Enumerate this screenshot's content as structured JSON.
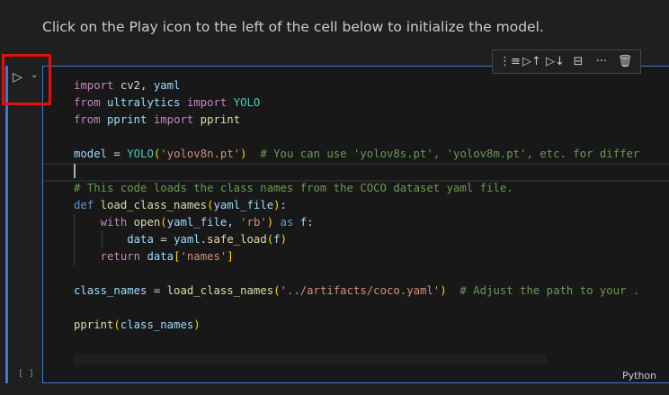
{
  "markdown_text": "Click on the Play icon to the left of the cell below to initialize the model.",
  "cell": {
    "run_icon": "▷",
    "run_menu_icon": "⌄",
    "execution_count": "[ ]",
    "language": "Python",
    "toolbar": [
      {
        "name": "run-by-line-icon",
        "glyph": "⋮≡"
      },
      {
        "name": "execute-above-icon",
        "glyph": "▷↑"
      },
      {
        "name": "execute-below-icon",
        "glyph": "▷↓"
      },
      {
        "name": "split-cell-icon",
        "glyph": "⊟"
      },
      {
        "name": "more-actions-icon",
        "glyph": "···"
      },
      {
        "name": "delete-cell-icon",
        "glyph": "🗑"
      }
    ],
    "code_lines": [
      [
        [
          "import",
          "k"
        ],
        [
          " cv2, ",
          "o"
        ],
        [
          "yaml",
          "v"
        ]
      ],
      [
        [
          "from",
          "k"
        ],
        [
          " ultralytics ",
          "v"
        ],
        [
          "import",
          "k"
        ],
        [
          " YOLO",
          "c"
        ]
      ],
      [
        [
          "from",
          "k"
        ],
        [
          " pprint ",
          "v"
        ],
        [
          "import",
          "k"
        ],
        [
          " pprint",
          "f"
        ]
      ],
      [],
      [
        [
          "model",
          "v"
        ],
        [
          " = ",
          "o"
        ],
        [
          "YOLO",
          "c"
        ],
        [
          "(",
          "p1"
        ],
        [
          "'yolov8n.pt'",
          "s"
        ],
        [
          ")",
          "p1"
        ],
        [
          "  # You can use 'yolov8s.pt', 'yolov8m.pt', etc. for differ",
          "m"
        ]
      ],
      [],
      [
        [
          "# This code loads the class names from the COCO dataset yaml file.",
          "m"
        ]
      ],
      [
        [
          "def",
          "d"
        ],
        [
          " ",
          "o"
        ],
        [
          "load_class_names",
          "f"
        ],
        [
          "(",
          "p1"
        ],
        [
          "yaml_file",
          "v"
        ],
        [
          ")",
          "p1"
        ],
        [
          ":",
          "o"
        ]
      ],
      [
        [
          "    ",
          "o"
        ],
        [
          "with",
          "k"
        ],
        [
          " ",
          "o"
        ],
        [
          "open",
          "f"
        ],
        [
          "(",
          "p1"
        ],
        [
          "yaml_file",
          "v"
        ],
        [
          ", ",
          "o"
        ],
        [
          "'rb'",
          "s"
        ],
        [
          ")",
          "p1"
        ],
        [
          " as ",
          "d"
        ],
        [
          "f",
          "v"
        ],
        [
          ":",
          "o"
        ]
      ],
      [
        [
          "        ",
          "o"
        ],
        [
          "data",
          "v"
        ],
        [
          " = ",
          "o"
        ],
        [
          "yaml",
          "v"
        ],
        [
          ".",
          "o"
        ],
        [
          "safe_load",
          "f"
        ],
        [
          "(",
          "p1"
        ],
        [
          "f",
          "v"
        ],
        [
          ")",
          "p1"
        ]
      ],
      [
        [
          "    ",
          "o"
        ],
        [
          "return",
          "k"
        ],
        [
          " ",
          "o"
        ],
        [
          "data",
          "v"
        ],
        [
          "[",
          "p1"
        ],
        [
          "'names'",
          "s"
        ],
        [
          "]",
          "p1"
        ]
      ],
      [],
      [
        [
          "class_names",
          "v"
        ],
        [
          " = ",
          "o"
        ],
        [
          "load_class_names",
          "f"
        ],
        [
          "(",
          "p1"
        ],
        [
          "'../artifacts/coco.yaml'",
          "s"
        ],
        [
          ")",
          "p1"
        ],
        [
          "  # Adjust the path to your .",
          "m"
        ]
      ],
      [],
      [
        [
          "pprint",
          "f"
        ],
        [
          "(",
          "p1"
        ],
        [
          "class_names",
          "v"
        ],
        [
          ")",
          "p1"
        ]
      ]
    ]
  }
}
